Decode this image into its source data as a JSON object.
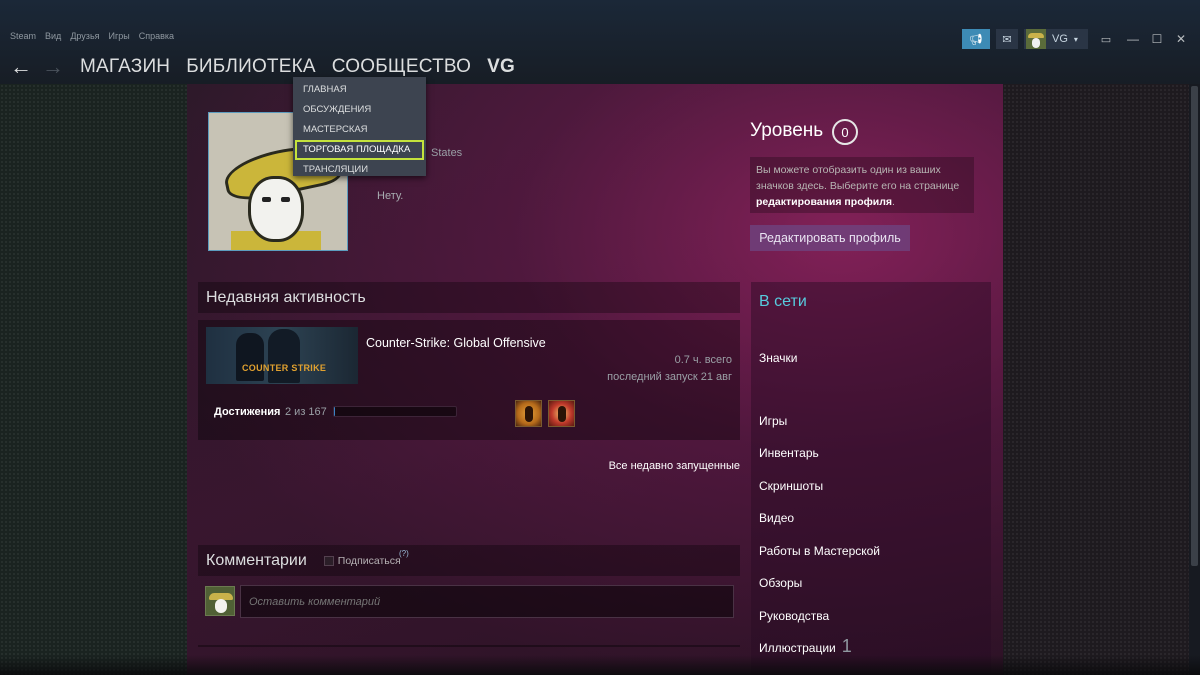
{
  "top_menu": [
    "Steam",
    "Вид",
    "Друзья",
    "Игры",
    "Справка"
  ],
  "account": {
    "name": "VG"
  },
  "nav": {
    "store": "МАГАЗИН",
    "library": "БИБЛИОТЕКА",
    "community": "СООБЩЕСТВО",
    "user": "VG"
  },
  "community_menu": {
    "items": [
      "ГЛАВНАЯ",
      "ОБСУЖДЕНИЯ",
      "МАСТЕРСКАЯ",
      "ТОРГОВАЯ ПЛОЩАДКА",
      "ТРАНСЛЯЦИИ"
    ],
    "highlighted": "ТОРГОВАЯ ПЛОЩАДКА"
  },
  "profile": {
    "country": "States",
    "summary": "Нету."
  },
  "level": {
    "label": "Уровень",
    "value": "0",
    "hint_prefix": "Вы можете отобразить один из ваших значков здесь. Выберите его на странице ",
    "hint_link": "редактирования профиля",
    "hint_suffix": ".",
    "edit_button": "Редактировать профиль"
  },
  "recent_activity": {
    "header": "Недавняя активность",
    "game": {
      "name": "Counter-Strike: Global Offensive",
      "capsule_text": "COUNTER STRIKE",
      "hours": "0.7 ч. всего",
      "last_played": "последний запуск 21 авг",
      "achievements_label": "Достижения",
      "achievements_count": "2 из 167",
      "achievements_progress": 0.012
    },
    "all_recent": "Все недавно запущенные"
  },
  "comments": {
    "header": "Комментарии",
    "subscribe": "Подписаться",
    "help": "(?)",
    "placeholder": "Оставить комментарий"
  },
  "sidebar": {
    "status": "В сети",
    "badges": "Значки",
    "links": [
      "Игры",
      "Инвентарь",
      "Скриншоты",
      "Видео",
      "Работы в Мастерской",
      "Обзоры",
      "Руководства",
      "Иллюстрации"
    ],
    "illustrations_count": "1"
  },
  "colors": {
    "online": "#57cbde",
    "highlight_border": "#c4e23c",
    "announce": "#3d8bb5"
  }
}
